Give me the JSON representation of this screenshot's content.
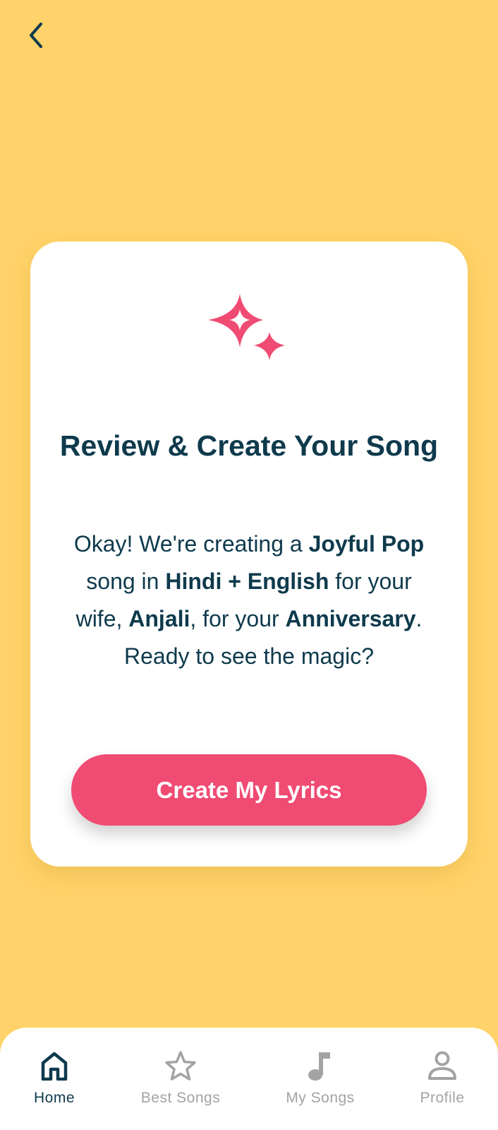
{
  "header": {
    "back_icon": "chevron-left-icon"
  },
  "card": {
    "icon": "sparkles-icon",
    "title": "Review & Create Your Song",
    "description": {
      "p1": "Okay! We're creating a ",
      "style": "Joyful Pop",
      "p2": " song in ",
      "language": "Hindi + English",
      "p3": " for your wife, ",
      "name": "Anjali",
      "p4": ", for your ",
      "occasion": "Anniversary",
      "p5": ". Ready to see the magic?"
    },
    "cta_label": "Create My Lyrics"
  },
  "nav": {
    "items": [
      {
        "label": "Home",
        "icon": "home-icon",
        "active": true
      },
      {
        "label": "Best Songs",
        "icon": "star-icon",
        "active": false
      },
      {
        "label": "My Songs",
        "icon": "music-note-icon",
        "active": false
      },
      {
        "label": "Profile",
        "icon": "user-icon",
        "active": false
      }
    ]
  },
  "colors": {
    "background": "#FFD369",
    "card": "#FFFFFF",
    "accent": "#F04B73",
    "text": "#0E3A4C",
    "inactive": "#A3A3A3"
  }
}
